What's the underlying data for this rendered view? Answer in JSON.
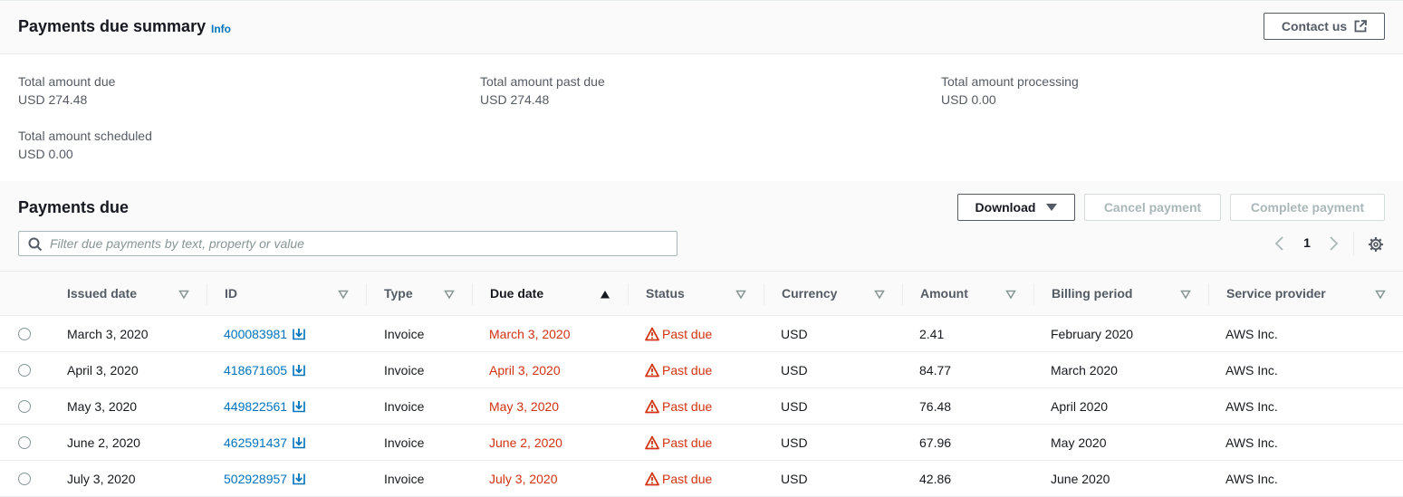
{
  "summary": {
    "title": "Payments due summary",
    "info_label": "Info",
    "contact_label": "Contact us",
    "fields": [
      {
        "label": "Total amount due",
        "value": "USD 274.48"
      },
      {
        "label": "Total amount past due",
        "value": "USD 274.48"
      },
      {
        "label": "Total amount processing",
        "value": "USD 0.00"
      },
      {
        "label": "Total amount scheduled",
        "value": "USD 0.00"
      }
    ]
  },
  "payments": {
    "title": "Payments due",
    "download_label": "Download",
    "cancel_label": "Cancel payment",
    "complete_label": "Complete payment",
    "filter_placeholder": "Filter due payments by text, property or value",
    "filter_value": "",
    "page": "1"
  },
  "table": {
    "columns": [
      "Issued date",
      "ID",
      "Type",
      "Due date",
      "Status",
      "Currency",
      "Amount",
      "Billing period",
      "Service provider"
    ],
    "sorted_column": "Due date",
    "rows": [
      {
        "issued": "March 3, 2020",
        "id": "400083981",
        "type": "Invoice",
        "due": "March 3, 2020",
        "status": "Past due",
        "currency": "USD",
        "amount": "2.41",
        "period": "February 2020",
        "provider": "AWS Inc."
      },
      {
        "issued": "April 3, 2020",
        "id": "418671605",
        "type": "Invoice",
        "due": "April 3, 2020",
        "status": "Past due",
        "currency": "USD",
        "amount": "84.77",
        "period": "March 2020",
        "provider": "AWS Inc."
      },
      {
        "issued": "May 3, 2020",
        "id": "449822561",
        "type": "Invoice",
        "due": "May 3, 2020",
        "status": "Past due",
        "currency": "USD",
        "amount": "76.48",
        "period": "April 2020",
        "provider": "AWS Inc."
      },
      {
        "issued": "June 2, 2020",
        "id": "462591437",
        "type": "Invoice",
        "due": "June 2, 2020",
        "status": "Past due",
        "currency": "USD",
        "amount": "67.96",
        "period": "May 2020",
        "provider": "AWS Inc."
      },
      {
        "issued": "July 3, 2020",
        "id": "502928957",
        "type": "Invoice",
        "due": "July 3, 2020",
        "status": "Past due",
        "currency": "USD",
        "amount": "42.86",
        "period": "June 2020",
        "provider": "AWS Inc."
      }
    ]
  },
  "colors": {
    "link": "#0073bb",
    "error": "#d13212",
    "border": "#eaeded",
    "header_bg": "#fafafa"
  },
  "icons": [
    "external-link-icon",
    "caret-down-icon",
    "search-icon",
    "chevron-left-icon",
    "chevron-right-icon",
    "gear-icon",
    "sort-caret-icon",
    "sort-ascending-icon",
    "download-icon",
    "warning-icon"
  ]
}
